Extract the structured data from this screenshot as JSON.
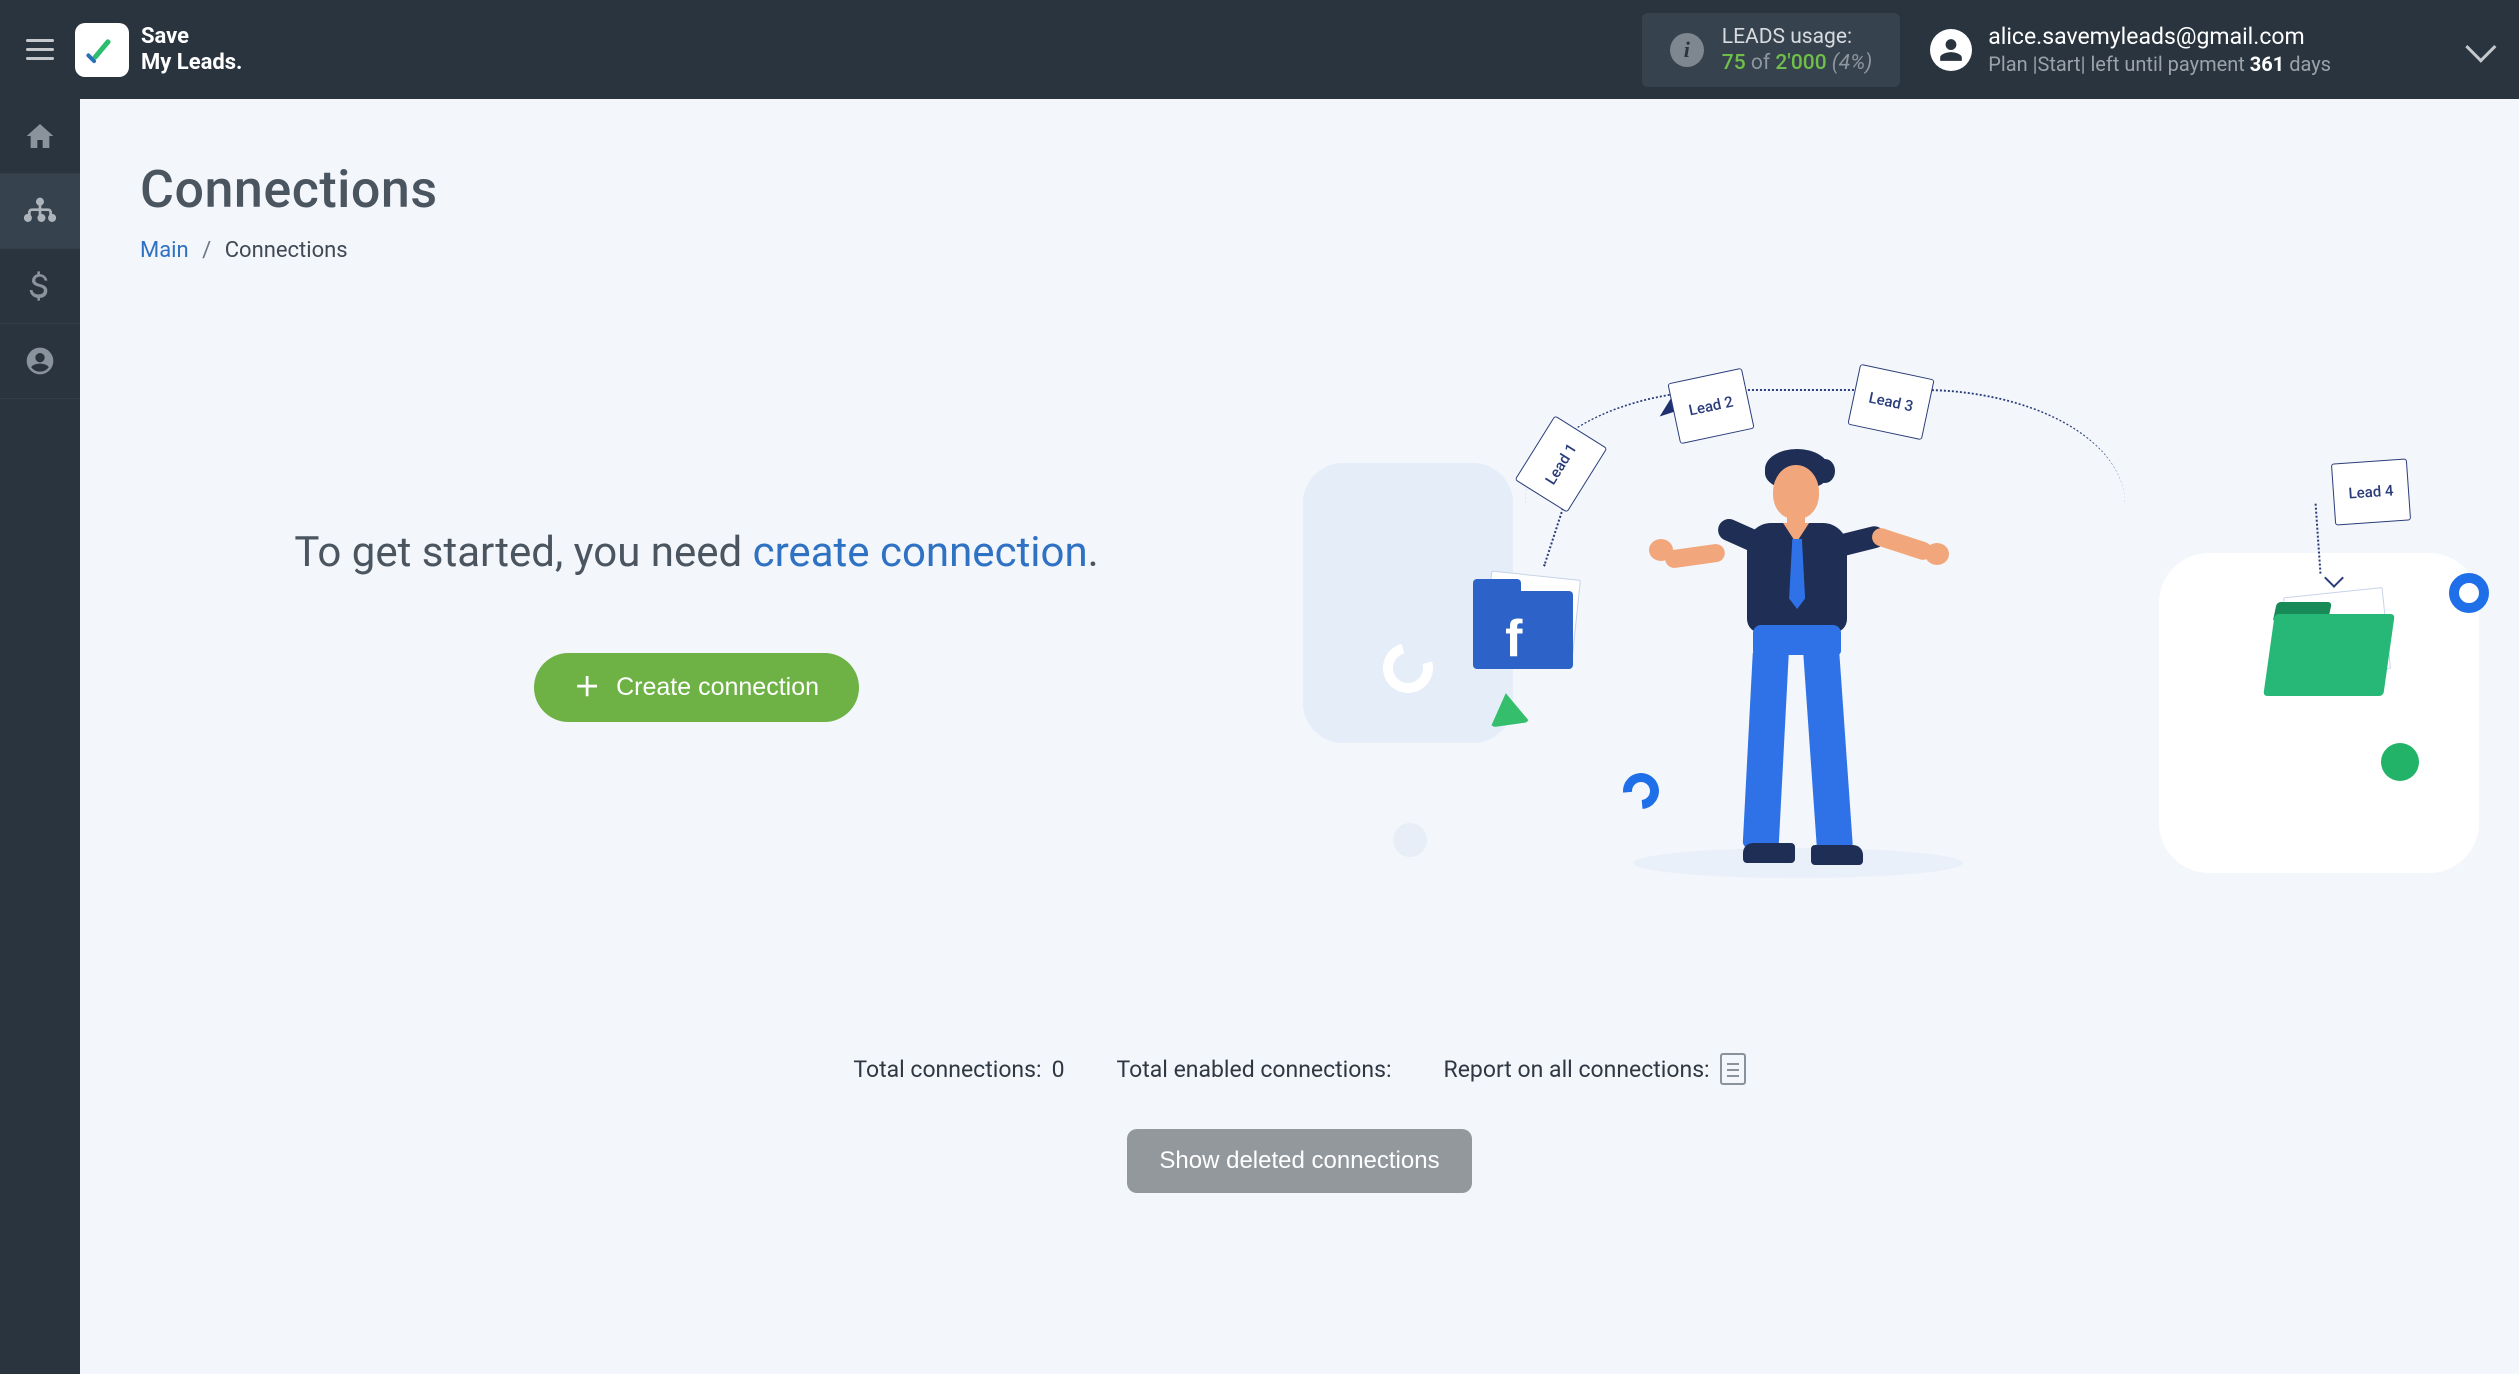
{
  "brand": {
    "line1": "Save",
    "line2": "My Leads."
  },
  "usage": {
    "label": "LEADS usage:",
    "count": "75",
    "of": " of ",
    "total": "2'000",
    "pct": " (4%)"
  },
  "account": {
    "email": "alice.savemyleads@gmail.com",
    "plan_prefix": "Plan |",
    "plan_name": "Start",
    "plan_mid": "| left until payment ",
    "days": "361",
    "days_suffix": " days"
  },
  "page": {
    "title": "Connections",
    "breadcrumb_main": "Main",
    "breadcrumb_current": "Connections"
  },
  "hero": {
    "text_before": "To get started, you need ",
    "link": "create connection",
    "text_after": ".",
    "button": "Create connection"
  },
  "leads": {
    "l1": "Lead 1",
    "l2": "Lead 2",
    "l3": "Lead 3",
    "l4": "Lead 4"
  },
  "stats": {
    "total_label": "Total connections: ",
    "total_value": "0",
    "enabled_label": "Total enabled connections:",
    "report_label": "Report on all connections:"
  },
  "footer": {
    "show_deleted": "Show deleted connections"
  }
}
